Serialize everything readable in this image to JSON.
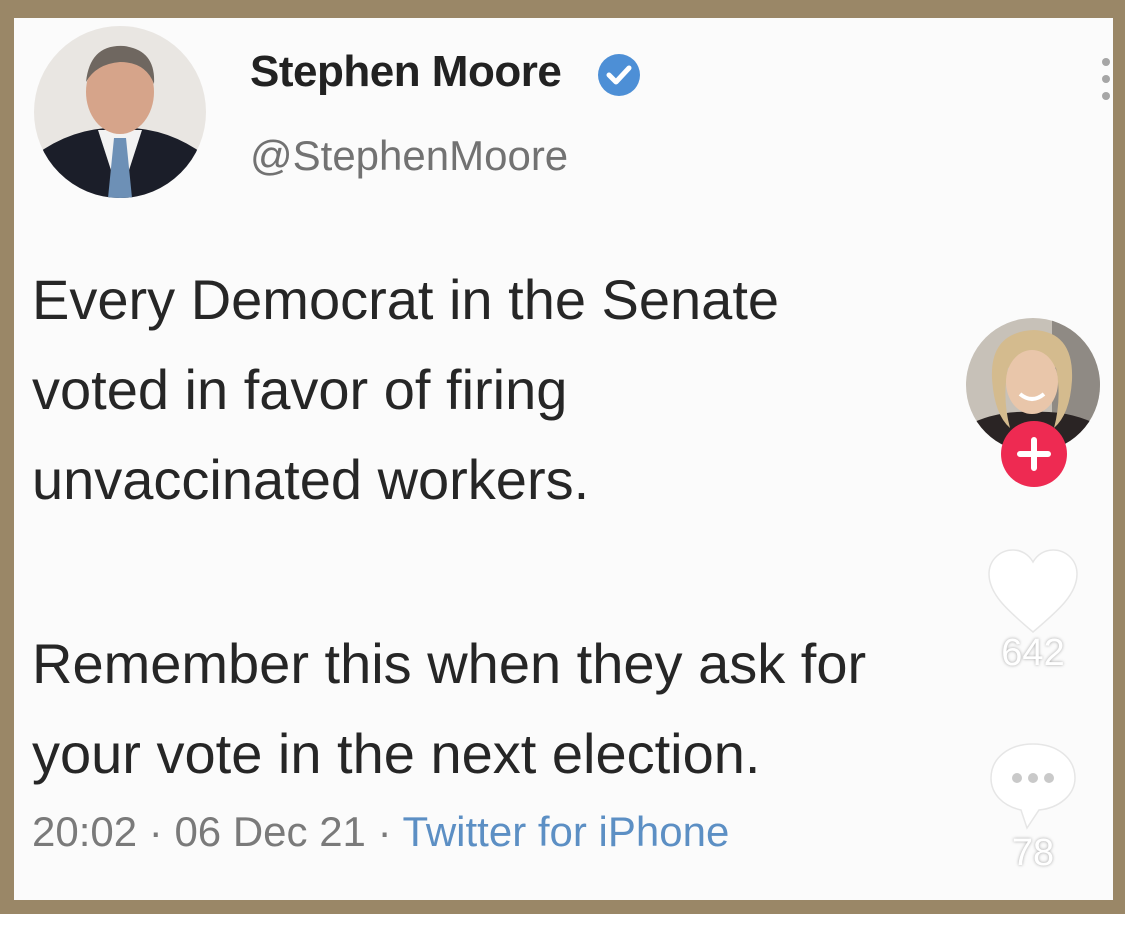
{
  "tweet": {
    "author_name": "Stephen Moore",
    "author_handle": "@StephenMoore",
    "text_lines": [
      "Every Democrat in the Senate",
      "voted in favor of firing",
      "unvaccinated workers.",
      "Remember this when they ask for",
      "your vote in the next election."
    ],
    "time": "20:02",
    "date": "06 Dec 21",
    "separator": "·",
    "source": "Twitter for iPhone",
    "verified_icon": "verified-badge-icon",
    "more_icon": "more-vertical-icon"
  },
  "overlay": {
    "creator_avatar": "avatar",
    "follow_icon": "plus-icon",
    "like_icon": "heart-icon",
    "like_count": "642",
    "comment_icon": "comment-bubble-icon",
    "comment_count": "78"
  },
  "colors": {
    "frame": "#9a8767",
    "verified": "#4d8fd6",
    "follow": "#ee2a52",
    "source_link": "#5c8fc4"
  }
}
